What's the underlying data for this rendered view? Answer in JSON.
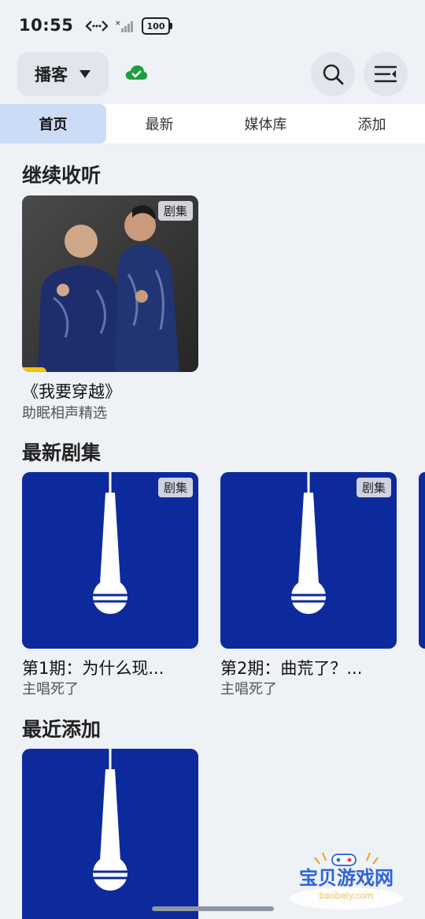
{
  "status_bar": {
    "time": "10:55",
    "battery": "100"
  },
  "app_bar": {
    "source_label": "播客"
  },
  "tabs": [
    {
      "label": "首页",
      "active": true
    },
    {
      "label": "最新",
      "active": false
    },
    {
      "label": "媒体库",
      "active": false
    },
    {
      "label": "添加",
      "active": false
    }
  ],
  "sections": {
    "continue": {
      "title": "继续收听",
      "items": [
        {
          "title": "《我要穿越》",
          "subtitle": "助眠相声精选",
          "badge": "剧集",
          "progress": 0.14
        }
      ]
    },
    "latest": {
      "title": "最新剧集",
      "items": [
        {
          "title": "第1期：为什么现...",
          "subtitle": "主唱死了",
          "badge": "剧集"
        },
        {
          "title": "第2期：曲荒了？...",
          "subtitle": "主唱死了",
          "badge": "剧集"
        }
      ]
    },
    "recent": {
      "title": "最近添加"
    }
  },
  "watermark": {
    "text": "宝贝游戏网",
    "url": "baobeiy.com"
  },
  "colors": {
    "podcast_blue": "#0d2a9d",
    "active_tab": "#cddcf6",
    "progress": "#f4c20d",
    "online_cloud": "#1e9e3e"
  }
}
